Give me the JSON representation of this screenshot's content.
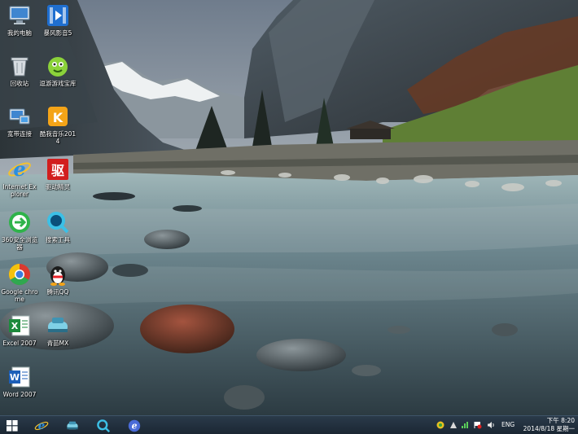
{
  "desktop": {
    "icons": [
      {
        "label": "我的电脑",
        "icon": "computer-icon"
      },
      {
        "label": "暴风影音5",
        "icon": "storm-player-icon"
      },
      {
        "label": "回收站",
        "icon": "recycle-bin-icon"
      },
      {
        "label": "逗游游戏宝库",
        "icon": "game-box-icon"
      },
      {
        "label": "宽带连接",
        "icon": "broadband-icon"
      },
      {
        "label": "酷我音乐2014",
        "icon": "kuwo-music-icon"
      },
      {
        "label": "Internet Explorer",
        "icon": "internet-explorer-icon"
      },
      {
        "label": "驱动精灵",
        "icon": "driver-genius-icon"
      },
      {
        "label": "360安全浏览器",
        "icon": "360-browser-icon"
      },
      {
        "label": "搜索工具",
        "icon": "search-tool-icon"
      },
      {
        "label": "Google chrome",
        "icon": "chrome-icon"
      },
      {
        "label": "腾讯QQ",
        "icon": "qq-icon"
      },
      {
        "label": "Excel 2007",
        "icon": "excel-icon"
      },
      {
        "label": "青苗MX",
        "icon": "boat-app-icon"
      },
      {
        "label": "Word 2007",
        "icon": "word-icon"
      }
    ]
  },
  "taskbar": {
    "start_icon": "windows-start-icon",
    "pinned": [
      "internet-explorer-icon",
      "boat-app-icon",
      "search-tool-icon",
      "ie-browser-icon"
    ],
    "tray_icons": [
      "shield-icon",
      "update-icon",
      "network-icon",
      "flag-icon",
      "volume-icon"
    ],
    "language": "ENG",
    "time": "下午 8:20",
    "date": "2014/8/18 星期一"
  },
  "colors": {
    "taskbar": "#1f2d3a",
    "label_text": "#ffffff"
  }
}
